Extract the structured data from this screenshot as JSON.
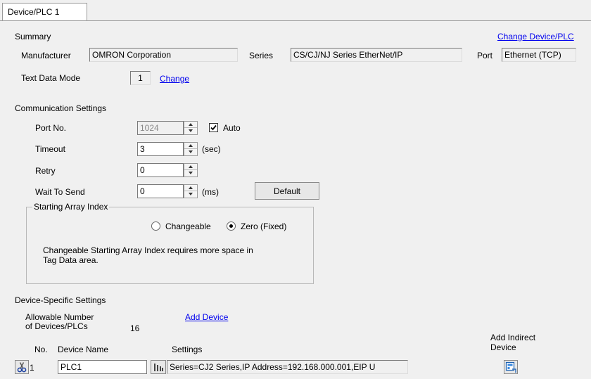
{
  "tab": {
    "label": "Device/PLC 1"
  },
  "summary": {
    "heading": "Summary",
    "change_device_link": "Change Device/PLC",
    "manufacturer_label": "Manufacturer",
    "manufacturer_value": "OMRON Corporation",
    "series_label": "Series",
    "series_value": "CS/CJ/NJ Series EtherNet/IP",
    "port_label": "Port",
    "port_value": "Ethernet (TCP)",
    "text_data_mode_label": "Text Data Mode",
    "text_data_mode_value": "1",
    "change_link": "Change"
  },
  "comm": {
    "heading": "Communication Settings",
    "port_no_label": "Port No.",
    "port_no_value": "1024",
    "auto_label": "Auto",
    "auto_checked": true,
    "timeout_label": "Timeout",
    "timeout_value": "3",
    "timeout_unit": "(sec)",
    "retry_label": "Retry",
    "retry_value": "0",
    "wait_label": "Wait To Send",
    "wait_value": "0",
    "wait_unit": "(ms)",
    "default_button": "Default",
    "array_group_label": "Starting Array Index",
    "changeable_label": "Changeable",
    "zero_label": "Zero (Fixed)",
    "selected": "zero",
    "note_line1": "Changeable Starting Array Index requires more space in",
    "note_line2": "Tag Data area."
  },
  "device_specific": {
    "heading": "Device-Specific Settings",
    "allowable_line1": "Allowable Number",
    "allowable_line2": "of Devices/PLCs",
    "allowable_value": "16",
    "add_device_link": "Add Device",
    "add_indirect_line1": "Add Indirect",
    "add_indirect_line2": "Device",
    "columns": {
      "no": "No.",
      "name": "Device Name",
      "settings": "Settings"
    },
    "rows": [
      {
        "no": "1",
        "name": "PLC1",
        "settings": "Series=CJ2 Series,IP Address=192.168.000.001,EIP U"
      }
    ]
  }
}
